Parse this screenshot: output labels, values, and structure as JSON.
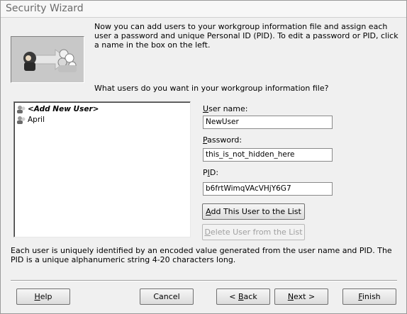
{
  "window": {
    "title": "Security Wizard"
  },
  "header": {
    "intro": "Now you can add users to your workgroup information file and assign each user a password and unique Personal ID (PID). To edit a password or PID, click a name in the box on the left.",
    "question": "What users do you want in your workgroup information file?"
  },
  "users_list": {
    "items": [
      {
        "label": "<Add New User>",
        "selected": true,
        "icon": "user-icon"
      },
      {
        "label": "April",
        "selected": false,
        "icon": "user-icon"
      }
    ]
  },
  "form": {
    "username": {
      "label_acc": "U",
      "label_rest": "ser name:",
      "value": "NewUser"
    },
    "password": {
      "label_acc": "P",
      "label_rest": "assword:",
      "value": "this_is_not_hidden_here"
    },
    "pid": {
      "label_pre": "P",
      "label_acc": "I",
      "label_rest": "D:",
      "value": "b6frtWimqVAcVHjY6G7"
    },
    "add_button": {
      "acc": "A",
      "rest": "dd This User to the List"
    },
    "delete_button": {
      "acc": "D",
      "rest": "elete User from the List"
    }
  },
  "footer_note": "Each user is uniquely identified by an encoded value generated from the user name and PID. The PID is a unique alphanumeric string 4-20 characters long.",
  "buttons": {
    "help": {
      "acc": "H",
      "rest": "elp"
    },
    "cancel": {
      "label": "Cancel"
    },
    "back": {
      "pre": "< ",
      "acc": "B",
      "rest": "ack"
    },
    "next": {
      "acc": "N",
      "rest": "ext >"
    },
    "finish": {
      "acc": "F",
      "rest": "inish"
    }
  },
  "colors": {
    "window_bg": "#f0f0f0",
    "title_text": "#6b6b6b",
    "disabled_text": "#a0a0a0"
  }
}
